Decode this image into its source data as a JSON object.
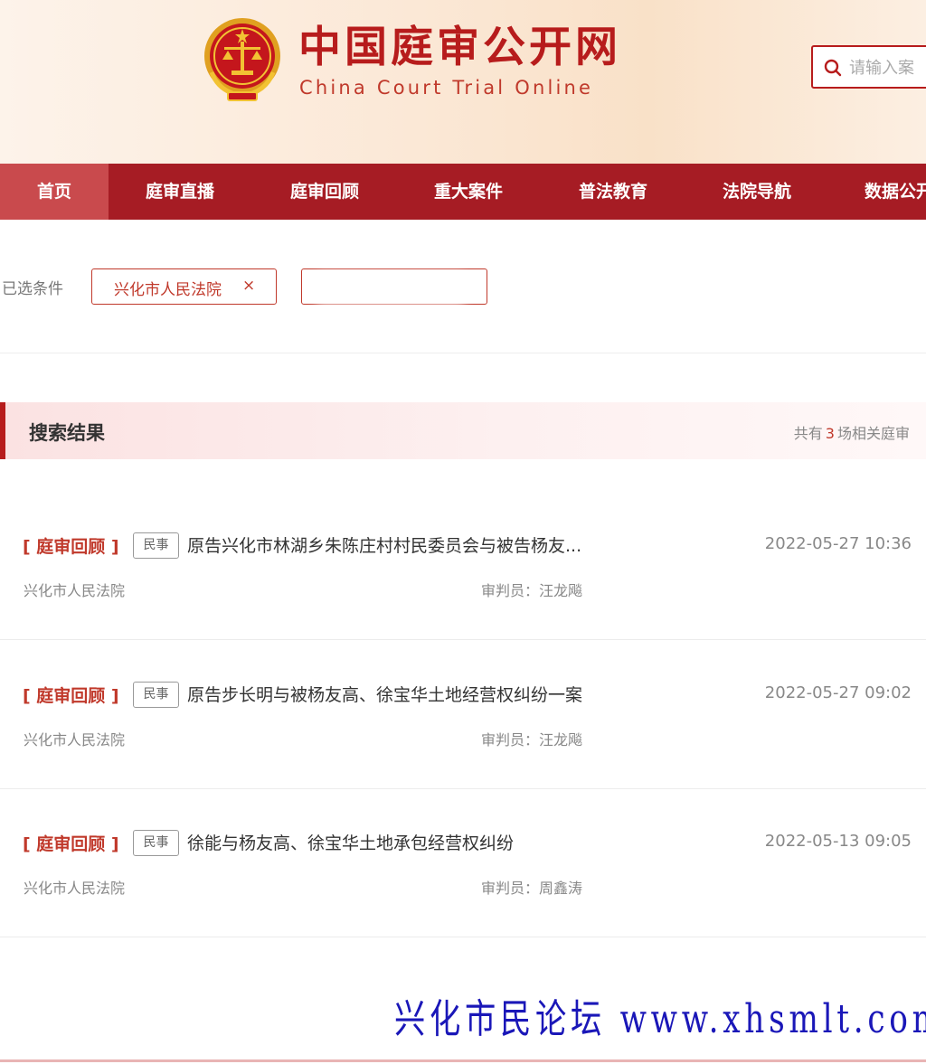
{
  "header": {
    "title": "中国庭审公开网",
    "subtitle": "China Court Trial Online",
    "search_placeholder": "请输入案"
  },
  "nav": {
    "items": [
      {
        "label": "首页",
        "active": true
      },
      {
        "label": "庭审直播",
        "active": false
      },
      {
        "label": "庭审回顾",
        "active": false
      },
      {
        "label": "重大案件",
        "active": false
      },
      {
        "label": "普法教育",
        "active": false
      },
      {
        "label": "法院导航",
        "active": false
      },
      {
        "label": "数据公开",
        "active": false
      }
    ]
  },
  "filters": {
    "label": "已选条件",
    "tags": [
      {
        "text": "兴化市人民法院",
        "close": "×"
      }
    ]
  },
  "results": {
    "title": "搜索结果",
    "count_prefix": "共有",
    "count": "3",
    "count_suffix": "场相关庭审",
    "items": [
      {
        "type": "[ 庭审回顾 ]",
        "badge": "民事",
        "title": "原告兴化市林湖乡朱陈庄村村民委员会与被告杨友...",
        "time": "2022-05-27 10:36",
        "court": "兴化市人民法院",
        "judge": "审判员：汪龙飚"
      },
      {
        "type": "[ 庭审回顾 ]",
        "badge": "民事",
        "title": "原告步长明与被杨友高、徐宝华土地经营权纠纷一案",
        "time": "2022-05-27 09:02",
        "court": "兴化市人民法院",
        "judge": "审判员：汪龙飚"
      },
      {
        "type": "[ 庭审回顾 ]",
        "badge": "民事",
        "title": "徐能与杨友高、徐宝华土地承包经营权纠纷",
        "time": "2022-05-13 09:05",
        "court": "兴化市人民法院",
        "judge": "审判员：周鑫涛"
      }
    ]
  },
  "watermark": "兴化市民论坛 www.xhsmlt.com",
  "colors": {
    "brand_red": "#a61c24",
    "accent_red": "#c0392b",
    "watermark_blue": "#1a17b8"
  }
}
